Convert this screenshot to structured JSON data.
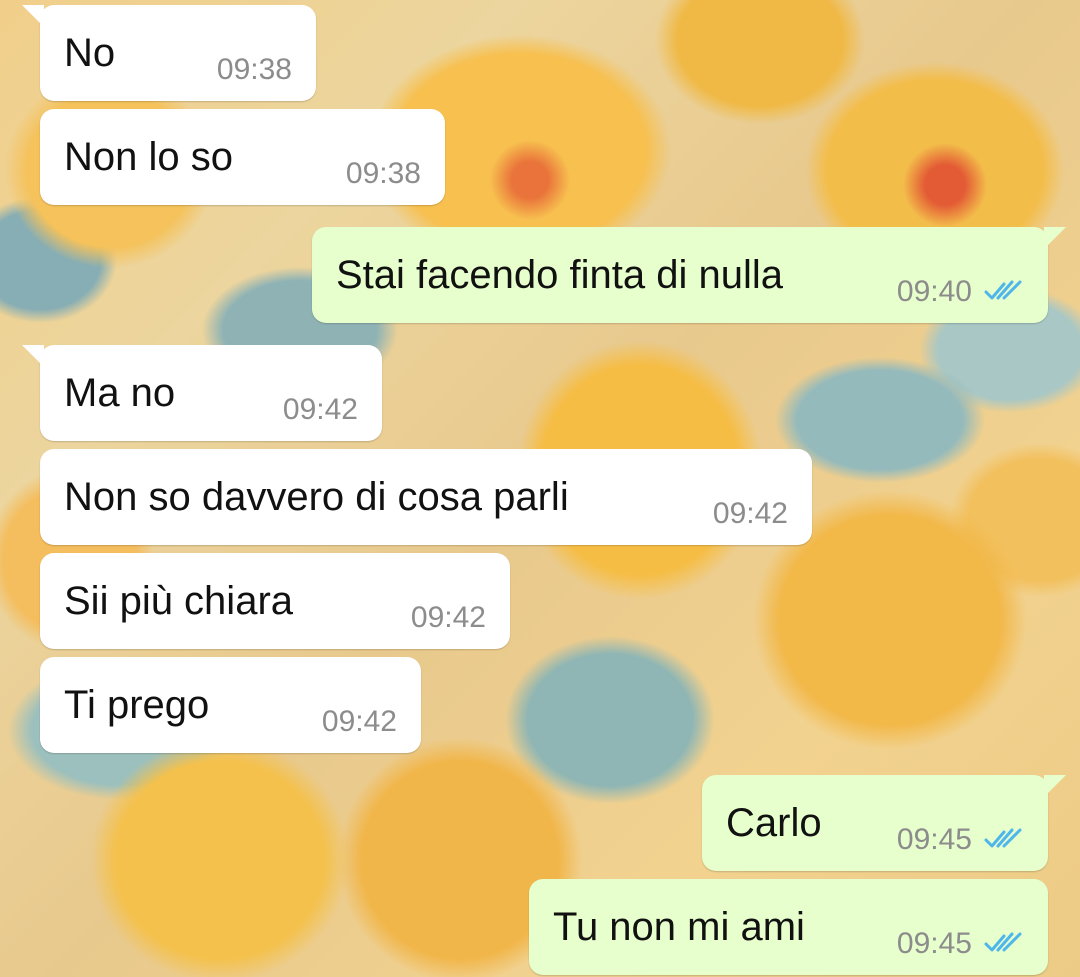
{
  "chat": {
    "messages": [
      {
        "direction": "incoming",
        "text": "No",
        "time": "09:38"
      },
      {
        "direction": "incoming",
        "text": "Non lo so",
        "time": "09:38"
      },
      {
        "direction": "outgoing",
        "text": "Stai facendo finta di nulla",
        "time": "09:40",
        "status": "read"
      },
      {
        "direction": "incoming",
        "text": "Ma no",
        "time": "09:42"
      },
      {
        "direction": "incoming",
        "text": "Non so davvero di cosa parli",
        "time": "09:42"
      },
      {
        "direction": "incoming",
        "text": "Sii più chiara",
        "time": "09:42"
      },
      {
        "direction": "incoming",
        "text": "Ti prego",
        "time": "09:42"
      },
      {
        "direction": "outgoing",
        "text": "Carlo",
        "time": "09:45",
        "status": "read"
      },
      {
        "direction": "outgoing",
        "text": "Tu non mi ami",
        "time": "09:45",
        "status": "read"
      }
    ]
  },
  "theme": {
    "incoming_bubble": "#ffffff",
    "outgoing_bubble": "#e6ffcc",
    "timestamp_color": "#8c8c8c",
    "read_tick_color": "#4fb6ec",
    "wallpaper": "yellow floral pattern"
  },
  "icons": {
    "read_receipt": "double-check-icon"
  }
}
